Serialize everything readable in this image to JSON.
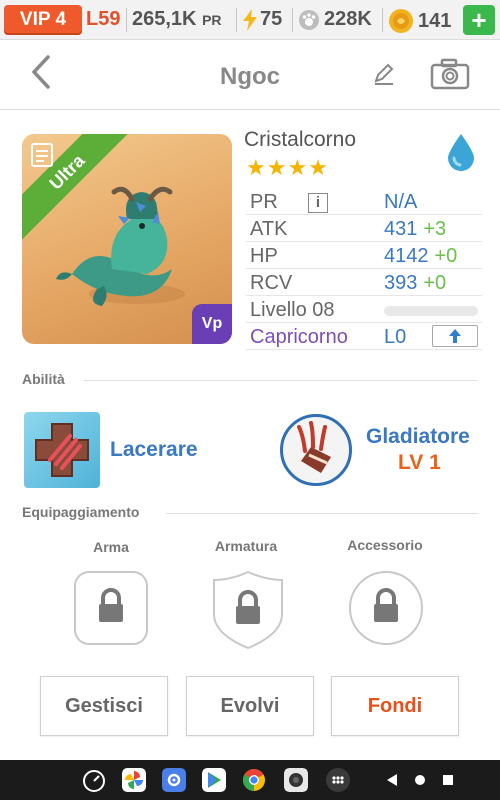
{
  "topbar": {
    "vip": "VIP 4",
    "level": "L59",
    "power_value": "265,1K",
    "power_unit": "PR",
    "energy": "75",
    "paw_count": "228K",
    "coins": "141",
    "add_label": "+"
  },
  "header": {
    "title": "Ngoc"
  },
  "monster": {
    "name": "Cristalcorno",
    "rarity": "Ultra",
    "badge": "Vp",
    "stars": "★★★★",
    "element_icon": "water-drop-icon"
  },
  "stats": [
    {
      "label": "PR",
      "value": "N/A",
      "bonus": ""
    },
    {
      "label": "ATK",
      "value": "431",
      "bonus": "+3"
    },
    {
      "label": "HP",
      "value": "4142",
      "bonus": "+0"
    },
    {
      "label": "RCV",
      "value": "393",
      "bonus": "+0"
    }
  ],
  "level_label": "Livello 08",
  "level_progress": 0,
  "zodiac": {
    "label": "Capricorno",
    "value": "L0"
  },
  "abilities": {
    "section_title": "Abilità",
    "skill": "Lacerare",
    "class_name": "Gladiatore",
    "class_level": "LV 1"
  },
  "equipment": {
    "section_title": "Equipaggiamento",
    "slots": [
      "Arma",
      "Armatura",
      "Accessorio"
    ]
  },
  "actions": {
    "manage": "Gestisci",
    "evolve": "Evolvi",
    "merge": "Fondi"
  },
  "colors": {
    "accent_orange": "#ee5a2b",
    "stat_blue": "#3a78c2",
    "bonus_green": "#6ac04a",
    "zodiac_purple": "#7c4fb8",
    "ultra_green": "#5cae38"
  }
}
